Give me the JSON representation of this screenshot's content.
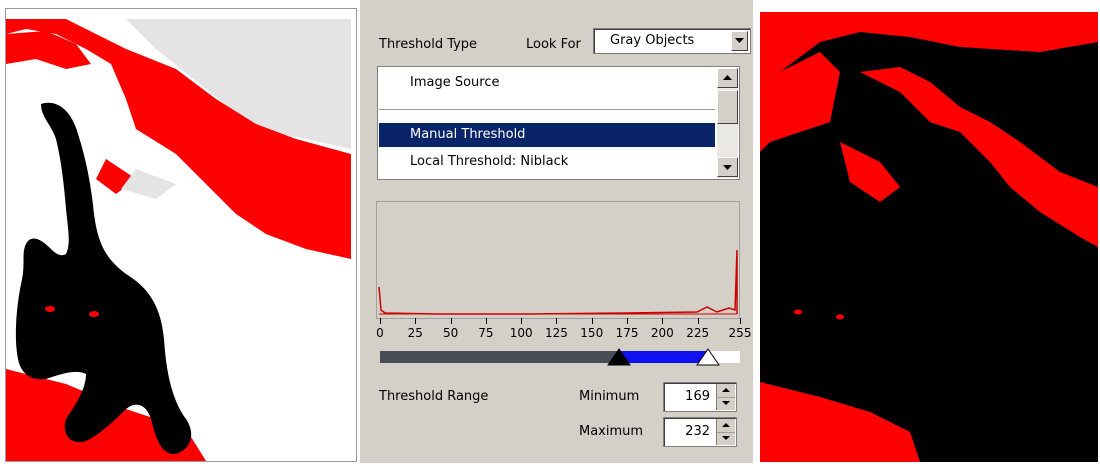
{
  "dialog": {
    "threshold_type_label": "Threshold Type",
    "look_for_label": "Look For",
    "look_for_value": "Gray Objects",
    "list_items": [
      "Image Source",
      "Manual Threshold",
      "Local Threshold: Niblack"
    ],
    "selected_item": "Manual Threshold",
    "axis_ticks": [
      "0",
      "25",
      "50",
      "75",
      "100",
      "125",
      "150",
      "175",
      "200",
      "225",
      "255"
    ],
    "threshold_range_label": "Threshold Range",
    "minimum_label": "Minimum",
    "minimum_value": "169",
    "maximum_label": "Maximum",
    "maximum_value": "232"
  },
  "colors": {
    "selection": "#0a246a",
    "threshold_overlay": "#ff0000",
    "range_bar": "#1010f0",
    "dialog_bg": "#d4d0c8"
  },
  "icons": [
    "dropdown-arrow-icon",
    "scroll-up-icon",
    "scroll-down-icon",
    "min-handle-icon",
    "max-handle-icon",
    "spin-up-icon",
    "spin-down-icon"
  ]
}
